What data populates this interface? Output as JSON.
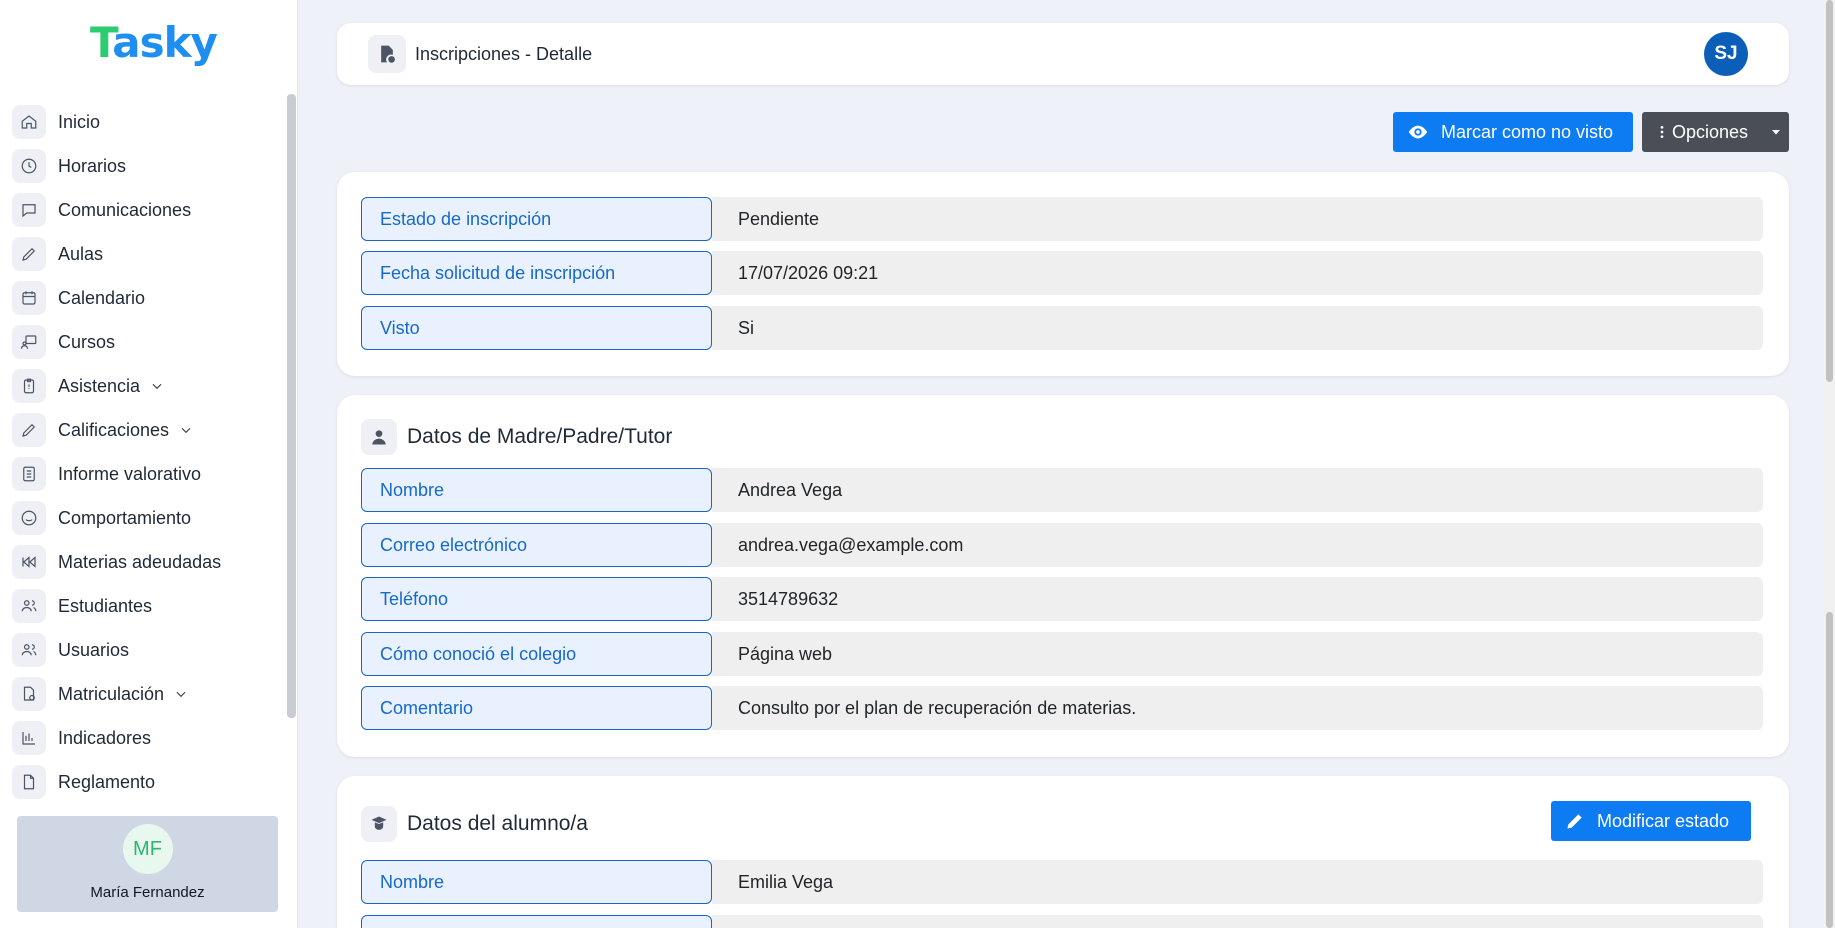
{
  "app": {
    "logo": "Tasky"
  },
  "sidebar": {
    "items": [
      {
        "label": "Inicio",
        "icon": "home-icon"
      },
      {
        "label": "Horarios",
        "icon": "clock-icon"
      },
      {
        "label": "Comunicaciones",
        "icon": "chat-icon"
      },
      {
        "label": "Aulas",
        "icon": "pencil-icon"
      },
      {
        "label": "Calendario",
        "icon": "calendar-icon"
      },
      {
        "label": "Cursos",
        "icon": "presentation-icon"
      },
      {
        "label": "Asistencia",
        "icon": "clipboard-icon",
        "expandable": true
      },
      {
        "label": "Calificaciones",
        "icon": "pencil-icon",
        "expandable": true
      },
      {
        "label": "Informe valorativo",
        "icon": "document-icon"
      },
      {
        "label": "Comportamiento",
        "icon": "smile-icon"
      },
      {
        "label": "Materias adeudadas",
        "icon": "rewind-icon"
      },
      {
        "label": "Estudiantes",
        "icon": "users-icon"
      },
      {
        "label": "Usuarios",
        "icon": "users-icon"
      },
      {
        "label": "Matriculación",
        "icon": "file-check-icon",
        "expandable": true
      },
      {
        "label": "Indicadores",
        "icon": "bar-chart-icon"
      },
      {
        "label": "Reglamento",
        "icon": "file-icon"
      }
    ],
    "user": {
      "initials": "MF",
      "name": "María Fernandez"
    }
  },
  "header": {
    "breadcrumb": "Inscripciones - Detalle",
    "avatar_initials": "SJ"
  },
  "actions": {
    "mark_unseen": "Marcar como no visto",
    "options": "Opciones"
  },
  "status_card": {
    "rows": [
      {
        "label": "Estado de inscripción",
        "value": "Pendiente"
      },
      {
        "label": "Fecha solicitud de inscripción",
        "value": "17/07/2026 09:21"
      },
      {
        "label": "Visto",
        "value": "Si"
      }
    ]
  },
  "parent_card": {
    "title": "Datos de Madre/Padre/Tutor",
    "rows": [
      {
        "label": "Nombre",
        "value": "Andrea Vega"
      },
      {
        "label": "Correo electrónico",
        "value": "andrea.vega@example.com"
      },
      {
        "label": "Teléfono",
        "value": "3514789632"
      },
      {
        "label": "Cómo conoció el colegio",
        "value": "Página web"
      },
      {
        "label": "Comentario",
        "value": "Consulto por el plan de recuperación de materias."
      }
    ]
  },
  "student_card": {
    "title": "Datos del alumno/a",
    "modify_button": "Modificar estado",
    "rows": [
      {
        "label": "Nombre",
        "value": "Emilia Vega"
      }
    ]
  },
  "colors": {
    "primary": "#0d7cf2",
    "secondary": "#4a4f57",
    "label_border": "#1a66c7",
    "logo": "#1f8ef1"
  }
}
